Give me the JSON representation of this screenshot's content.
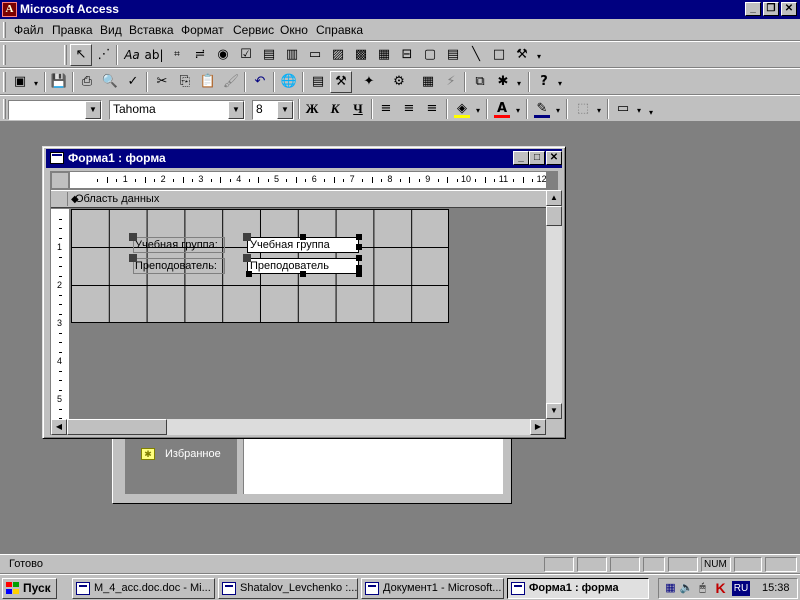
{
  "app": {
    "title": "Microsoft Access"
  },
  "menu": [
    "Файл",
    "Правка",
    "Вид",
    "Вставка",
    "Формат",
    "Сервис",
    "Окно",
    "Справка"
  ],
  "format_toolbar": {
    "object_combo": "",
    "font_combo": "Tahoma",
    "size_combo": "8"
  },
  "toolbox_icons": [
    "pointer-icon",
    "wizard-icon",
    "label-icon",
    "textbox-icon",
    "option-group-icon",
    "toggle-icon",
    "option-button-icon",
    "checkbox-icon",
    "combo-box-icon",
    "list-box-icon",
    "command-button-icon",
    "image-icon",
    "unbound-frame-icon",
    "bound-frame-icon",
    "page-break-icon",
    "tab-control-icon",
    "subform-icon",
    "line-icon",
    "rectangle-icon",
    "more-controls-icon"
  ],
  "form_window": {
    "title": "Форма1 : форма",
    "section_label": "Область данных",
    "ruler_h": [
      "1",
      "2",
      "3",
      "4",
      "5",
      "6",
      "7",
      "8",
      "9",
      "10",
      "11",
      "12"
    ],
    "ruler_v": [
      "1",
      "2",
      "3",
      "4",
      "5"
    ],
    "controls": [
      {
        "label": "Учебная группа:",
        "field": "Учебная группа"
      },
      {
        "label": "Преподователь:",
        "field": "Преподователь"
      }
    ]
  },
  "db_window": {
    "favorites_label": "Избранное"
  },
  "status": {
    "text": "Готово",
    "num_indicator": "NUM"
  },
  "taskbar": {
    "start_label": "Пуск",
    "tasks": [
      {
        "label": "M_4_acc.doc.doc - Mi...",
        "active": false
      },
      {
        "label": "Shatalov_Levchenko :...",
        "active": false
      },
      {
        "label": "Документ1 - Microsoft...",
        "active": false
      },
      {
        "label": "Форма1 : форма",
        "active": true
      }
    ],
    "lang": "RU",
    "clock": "15:38"
  },
  "colors": {
    "titlebar": "#000080",
    "face": "#c0c0c0",
    "desktop": "#808080"
  }
}
